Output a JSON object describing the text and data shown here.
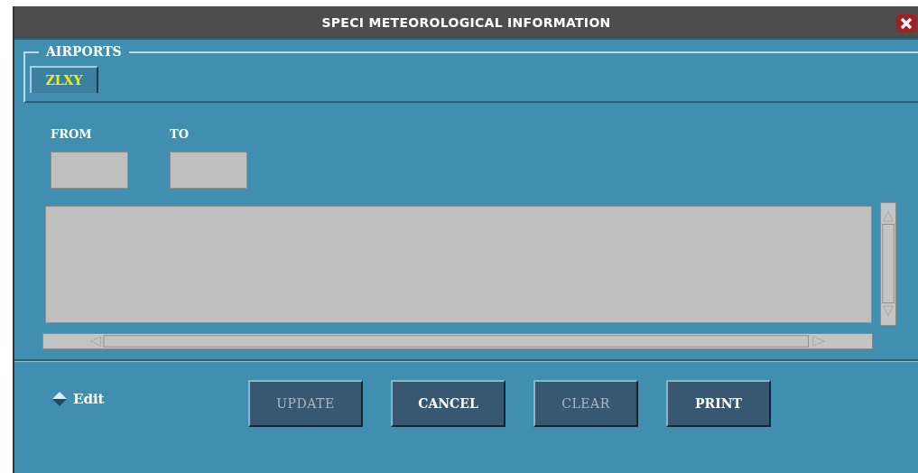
{
  "window": {
    "title": "SPECI METEOROLOGICAL INFORMATION"
  },
  "airports": {
    "label": "AIRPORTS",
    "tabs": [
      {
        "label": "ZLXY",
        "selected": true
      }
    ]
  },
  "range": {
    "from_label": "FROM",
    "to_label": "TO"
  },
  "edit_toggle": {
    "label": "Edit",
    "checked": false
  },
  "buttons": [
    {
      "label": "UPDATE",
      "disabled": true
    },
    {
      "label": "CANCEL",
      "disabled": false
    },
    {
      "label": "CLEAR",
      "disabled": true
    },
    {
      "label": "PRINT",
      "disabled": false
    }
  ]
}
